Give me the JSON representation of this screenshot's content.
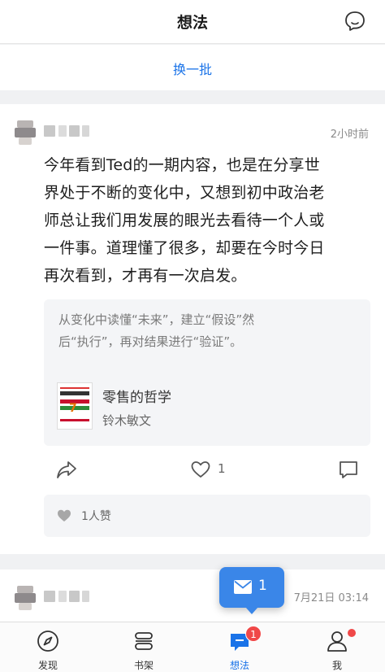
{
  "header": {
    "title": "想法",
    "action_icon": "chat-bubble-icon"
  },
  "refresh": {
    "label": "换一批"
  },
  "post": {
    "time": "2小时前",
    "text": "今年看到Ted的一期内容，也是在分享世\n界处于不断的变化中，又想到初中政治老\n师总让我们用发展的眼光去看待一个人或\n一件事。道理懂了很多，却要在今时今日\n再次看到，才再有一次启发。",
    "quote": "从变化中读懂“未来”，建立“假设”然\n后“执行”，再对结果进行“验证”。",
    "book": {
      "title": "零售的哲学",
      "author": "铃木敏文"
    },
    "like_count": "1",
    "likes_summary": "1人赞"
  },
  "post2": {
    "time": "7月21日 03:14"
  },
  "toast": {
    "count": "1",
    "icon": "mail-icon"
  },
  "tabs": [
    {
      "label": "发现",
      "icon": "compass-icon"
    },
    {
      "label": "书架",
      "icon": "bookshelf-icon"
    },
    {
      "label": "想法",
      "icon": "thoughts-icon",
      "badge": "1",
      "active": true
    },
    {
      "label": "我",
      "icon": "profile-icon",
      "dot": true
    }
  ],
  "colors": {
    "accent": "#1a73e8",
    "badge": "#f04848",
    "toast": "#3a86e8"
  }
}
